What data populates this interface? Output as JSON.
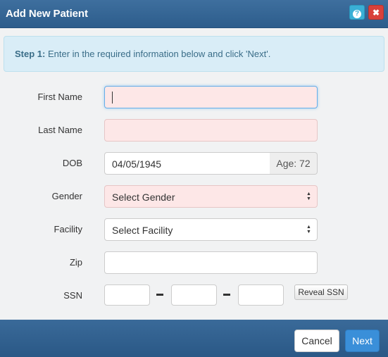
{
  "dialog": {
    "title": "Add New Patient",
    "help_icon": "question-icon",
    "close_icon": "close-icon",
    "help_glyph": "?",
    "close_glyph": "✖"
  },
  "info": {
    "step_label": "Step 1:",
    "text": " Enter in the required information below and click 'Next'."
  },
  "form": {
    "first_name": {
      "label": "First Name",
      "value": ""
    },
    "last_name": {
      "label": "Last Name",
      "value": ""
    },
    "dob": {
      "label": "DOB",
      "value": "04/05/1945",
      "age": "Age: 72"
    },
    "gender": {
      "label": "Gender",
      "selected": "Select Gender"
    },
    "facility": {
      "label": "Facility",
      "selected": "Select Facility"
    },
    "zip": {
      "label": "Zip",
      "value": ""
    },
    "ssn": {
      "label": "SSN",
      "reveal_label": "Reveal SSN"
    }
  },
  "footer": {
    "cancel_label": "Cancel",
    "next_label": "Next"
  },
  "colors": {
    "header": "#2d5d8c",
    "required_field": "#fde7e7",
    "info_bg": "#d9edf7",
    "primary_button": "#3a8fd9",
    "close_button": "#d9403a",
    "help_button": "#3ab0d6"
  }
}
